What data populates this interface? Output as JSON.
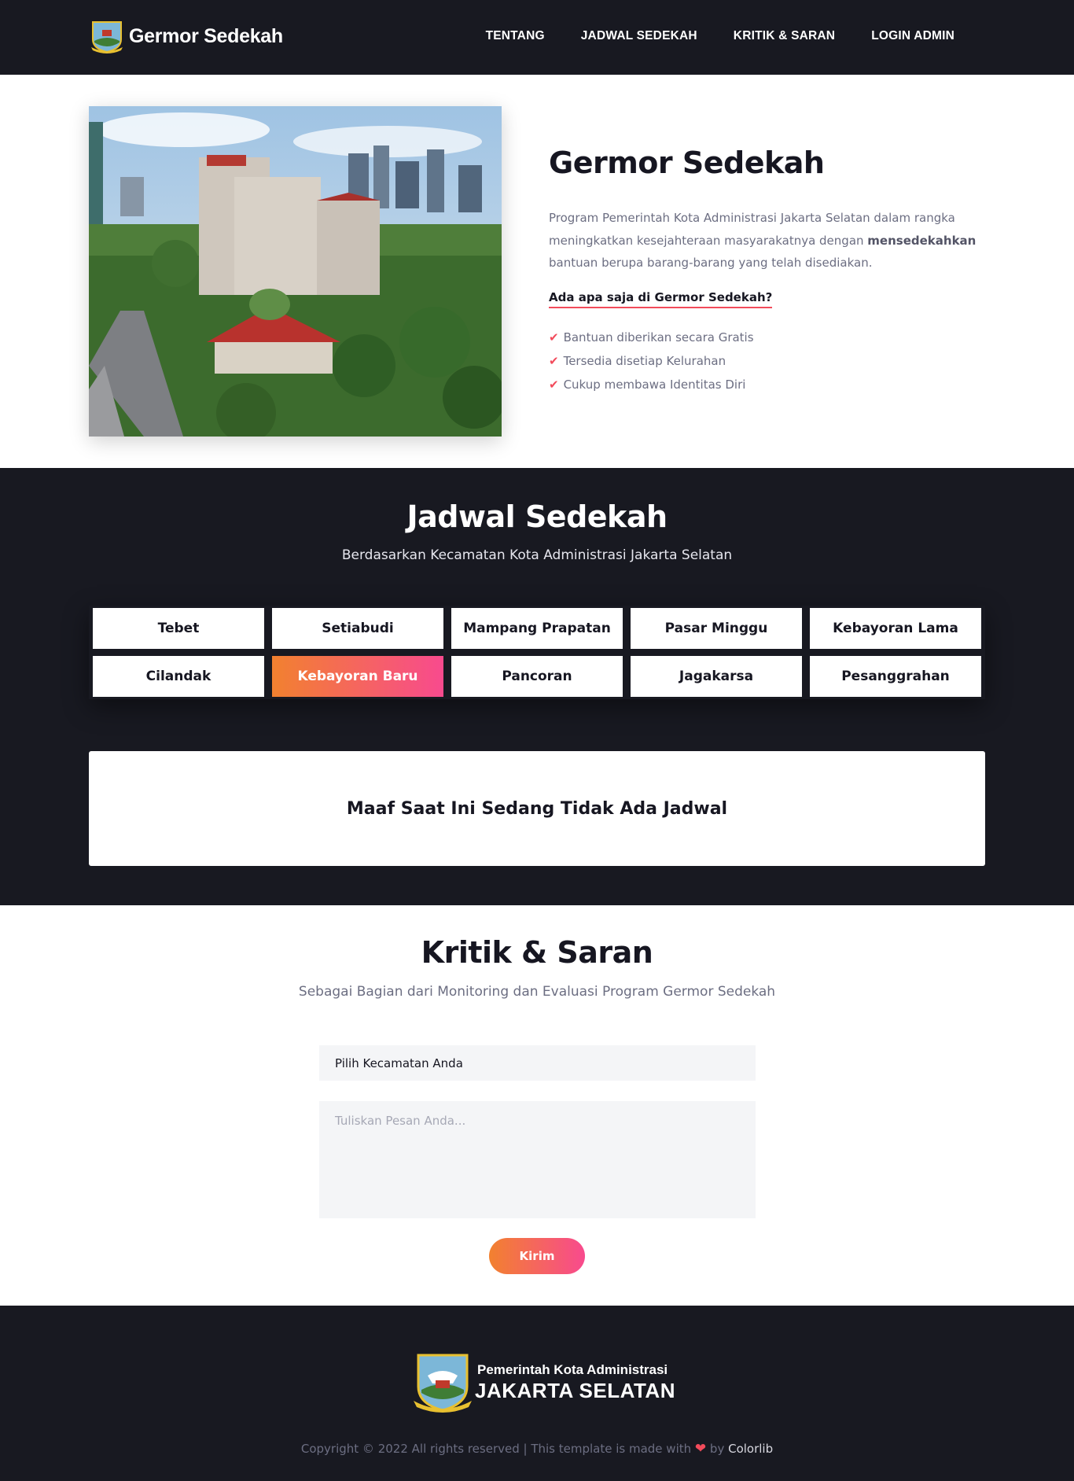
{
  "header": {
    "brand": "Germor Sedekah",
    "nav": [
      {
        "label": "TENTANG"
      },
      {
        "label": "JADWAL SEDEKAH"
      },
      {
        "label": "KRITIK & SARAN"
      },
      {
        "label": "LOGIN ADMIN"
      }
    ]
  },
  "about": {
    "title": "Germor Sedekah",
    "desc_before": "Program Pemerintah Kota Administrasi Jakarta Selatan dalam rangka meningkatkan kesejahteraan masyarakatnya dengan ",
    "desc_bold": "mensedekahkan",
    "desc_after": " bantuan berupa barang-barang yang telah disediakan.",
    "question": "Ada apa saja di Germor Sedekah?",
    "features": [
      "Bantuan diberikan secara Gratis",
      "Tersedia disetiap Kelurahan",
      "Cukup membawa Identitas Diri"
    ]
  },
  "schedule": {
    "title": "Jadwal Sedekah",
    "subtitle": "Berdasarkan Kecamatan Kota Administrasi Jakarta Selatan",
    "districts": [
      "Tebet",
      "Setiabudi",
      "Mampang Prapatan",
      "Pasar Minggu",
      "Kebayoran Lama",
      "Cilandak",
      "Kebayoran Baru",
      "Pancoran",
      "Jagakarsa",
      "Pesanggrahan"
    ],
    "active_district": "Kebayoran Baru",
    "notice": "Maaf Saat Ini Sedang Tidak Ada Jadwal"
  },
  "feedback": {
    "title": "Kritik & Saran",
    "subtitle": "Sebagai Bagian dari Monitoring dan Evaluasi Program Germor Sedekah",
    "select_value": "Pilih Kecamatan Anda",
    "message_placeholder": "Tuliskan Pesan Anda...",
    "submit_label": "Kirim"
  },
  "footer": {
    "line1": "Pemerintah Kota Administrasi",
    "line2": "JAKARTA SELATAN",
    "copyright_before": "Copyright © 2022 All rights reserved | This template is made with ",
    "copyright_by": " by ",
    "credit": "Colorlib"
  },
  "colors": {
    "dark": "#181921",
    "accent_red": "#f24b5b",
    "gradient_start": "#f2812f",
    "gradient_end": "#f84a8e",
    "muted_text": "#6c6e82"
  }
}
